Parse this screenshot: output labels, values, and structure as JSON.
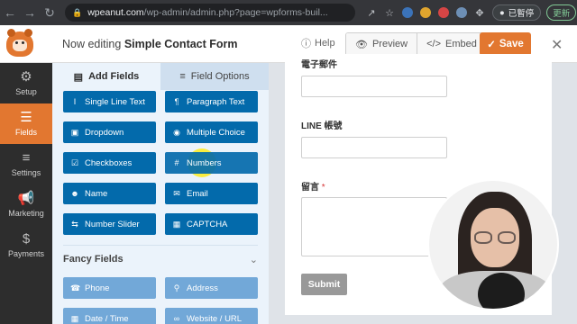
{
  "browser": {
    "url_host": "wpeanut.com",
    "url_path": "/wp-admin/admin.php?page=wpforms-buil...",
    "paused_label": "已暫停",
    "update_label": "更新"
  },
  "header": {
    "editing_prefix": "Now editing",
    "form_name": "Simple Contact Form",
    "help_label": "Help",
    "preview_label": "Preview",
    "embed_label": "Embed",
    "save_label": "Save"
  },
  "sidebar": {
    "items": [
      {
        "label": "Setup",
        "icon": "gear-icon",
        "active": false
      },
      {
        "label": "Fields",
        "icon": "list-icon",
        "active": true
      },
      {
        "label": "Settings",
        "icon": "sliders-icon",
        "active": false
      },
      {
        "label": "Marketing",
        "icon": "megaphone-icon",
        "active": false
      },
      {
        "label": "Payments",
        "icon": "dollar-icon",
        "active": false
      }
    ]
  },
  "panel": {
    "tab_add": "Add Fields",
    "tab_options": "Field Options",
    "fields": [
      {
        "label": "Single Line Text",
        "icon": "text-cursor-icon"
      },
      {
        "label": "Paragraph Text",
        "icon": "paragraph-icon"
      },
      {
        "label": "Dropdown",
        "icon": "dropdown-icon"
      },
      {
        "label": "Multiple Choice",
        "icon": "radio-icon"
      },
      {
        "label": "Checkboxes",
        "icon": "checkbox-icon"
      },
      {
        "label": "Numbers",
        "icon": "hash-icon"
      },
      {
        "label": "Name",
        "icon": "user-icon"
      },
      {
        "label": "Email",
        "icon": "envelope-icon"
      },
      {
        "label": "Number Slider",
        "icon": "slider-icon"
      },
      {
        "label": "CAPTCHA",
        "icon": "captcha-icon"
      }
    ],
    "fancy_title": "Fancy Fields",
    "fancy_fields": [
      {
        "label": "Phone",
        "icon": "phone-icon"
      },
      {
        "label": "Address",
        "icon": "map-pin-icon"
      },
      {
        "label": "Date / Time",
        "icon": "calendar-icon"
      },
      {
        "label": "Website / URL",
        "icon": "link-icon"
      }
    ]
  },
  "form": {
    "email_label": "電子郵件",
    "line_label": "LINE 帳號",
    "message_label": "留言",
    "required_mark": "*",
    "submit_label": "Submit"
  },
  "colors": {
    "brand_orange": "#e27730",
    "field_blue": "#036aab",
    "sidebar_dark": "#2d2d2d"
  }
}
